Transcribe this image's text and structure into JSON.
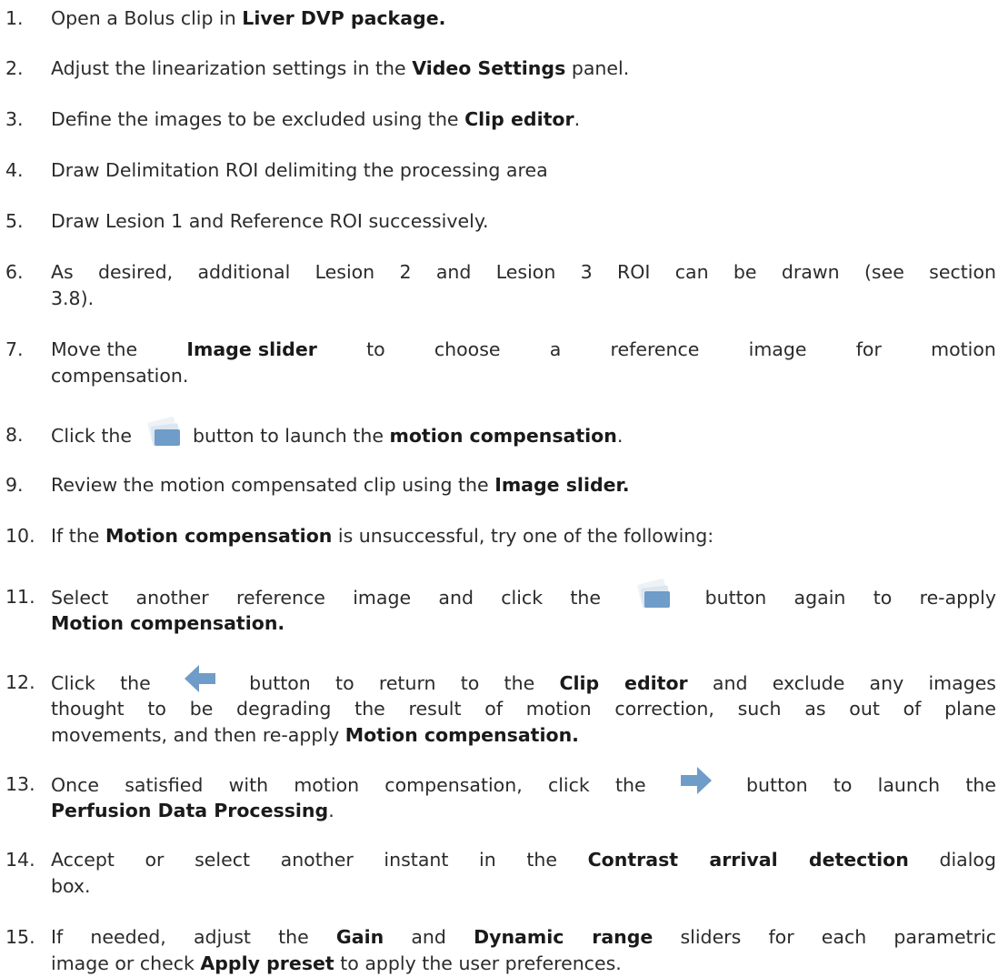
{
  "steps": [
    {
      "n": "1.",
      "parts": [
        "Open a Bolus clip in ",
        "Liver DVP package.",
        ""
      ]
    },
    {
      "n": "2.",
      "parts": [
        "Adjust the linearization settings in the ",
        "Video Settings",
        " panel."
      ]
    },
    {
      "n": "3.",
      "parts": [
        "Define the images to be excluded using the ",
        "Clip editor",
        "."
      ]
    },
    {
      "n": "4.",
      "parts": [
        "Draw Delimitation ROI delimiting the processing area"
      ]
    },
    {
      "n": "5.",
      "parts": [
        "Draw Lesion 1 and Reference ROI successively."
      ]
    },
    {
      "n": "6.",
      "parts": [
        "As desired, additional Lesion 2 and Lesion 3 ROI can be drawn (see section",
        "3.8)."
      ]
    },
    {
      "n": "7.",
      "parts": [
        "Move the",
        "Image slider",
        "to",
        "choose",
        "a",
        "reference",
        "image",
        "for",
        "motion",
        "compensation."
      ]
    },
    {
      "n": "8.",
      "parts": [
        "Click the ",
        " button to launch the ",
        "motion compensation",
        "."
      ]
    },
    {
      "n": "9.",
      "parts": [
        "Review the motion compensated clip using the ",
        "Image slider."
      ]
    },
    {
      "n": "10.",
      "parts": [
        "If the ",
        "Motion compensation",
        " is unsuccessful, try one of the following:"
      ]
    },
    {
      "n": "11.",
      "parts": [
        "Select another reference image and click the ",
        " button again to re-apply",
        "Motion compensation."
      ]
    },
    {
      "n": "12.",
      "parts": [
        "Click the ",
        " button to return to the ",
        "Clip editor",
        " and exclude any images",
        "thought to be degrading the result of motion correction, such as out of plane",
        "movements, and then re-apply ",
        "Motion compensation."
      ]
    },
    {
      "n": "13.",
      "parts": [
        "Once satisfied with motion compensation, click the ",
        " button to launch the",
        "Perfusion Data Processing",
        "."
      ]
    },
    {
      "n": "14.",
      "parts": [
        "Accept or select another instant in the ",
        "Contrast arrival detection",
        " dialog",
        "box."
      ]
    },
    {
      "n": "15.",
      "parts": [
        "If needed, adjust the ",
        "Gain",
        " and ",
        "Dynamic range",
        " sliders for each parametric",
        "image or check ",
        "Apply preset",
        " to apply the user preferences."
      ]
    }
  ],
  "icons": {
    "motion": "motion-compensation-icon",
    "back": "back-arrow-icon",
    "forward": "forward-arrow-icon"
  },
  "colors": {
    "icon_blue": "#6f9cc8",
    "icon_light": "#dce6f0"
  }
}
